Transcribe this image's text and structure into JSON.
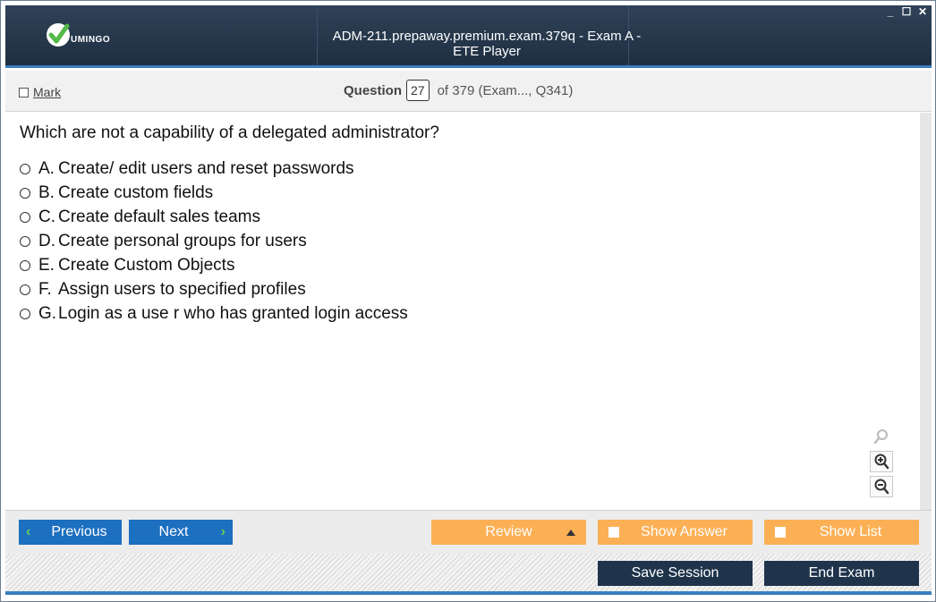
{
  "app": {
    "logo_text": "UMINGO",
    "title": "ADM-211.prepaway.premium.exam.379q - Exam A - ETE Player",
    "window_controls": [
      "_",
      "☐",
      "✕"
    ]
  },
  "header": {
    "mark_label": "Mark",
    "question_label": "Question",
    "question_number": "27",
    "question_of": "of 379 (Exam..., Q341)"
  },
  "question": {
    "text": "Which are not a capability of a delegated administrator?",
    "options": [
      {
        "letter": "A.",
        "text": "Create/ edit users and reset passwords"
      },
      {
        "letter": "B.",
        "text": "Create custom fields"
      },
      {
        "letter": "C.",
        "text": "Create default sales teams"
      },
      {
        "letter": "D.",
        "text": "Create personal groups for users"
      },
      {
        "letter": "E.",
        "text": "Create Custom Objects"
      },
      {
        "letter": "F.",
        "text": "Assign users to specified profiles"
      },
      {
        "letter": "G.",
        "text": "Login as a use r who has granted login access"
      }
    ]
  },
  "zoom": {
    "icons": [
      "search-icon",
      "zoom-in-icon",
      "zoom-out-icon"
    ]
  },
  "nav": {
    "previous": "Previous",
    "next": "Next",
    "review": "Review",
    "show_answer": "Show Answer",
    "show_list": "Show List"
  },
  "footer": {
    "save_session": "Save Session",
    "end_exam": "End Exam"
  },
  "colors": {
    "titlebar": "#1f2f42",
    "accent_blue": "#1d6fc0",
    "orange": "#fcb055",
    "dark_button": "#1f344b",
    "logo_green": "#55b948"
  }
}
